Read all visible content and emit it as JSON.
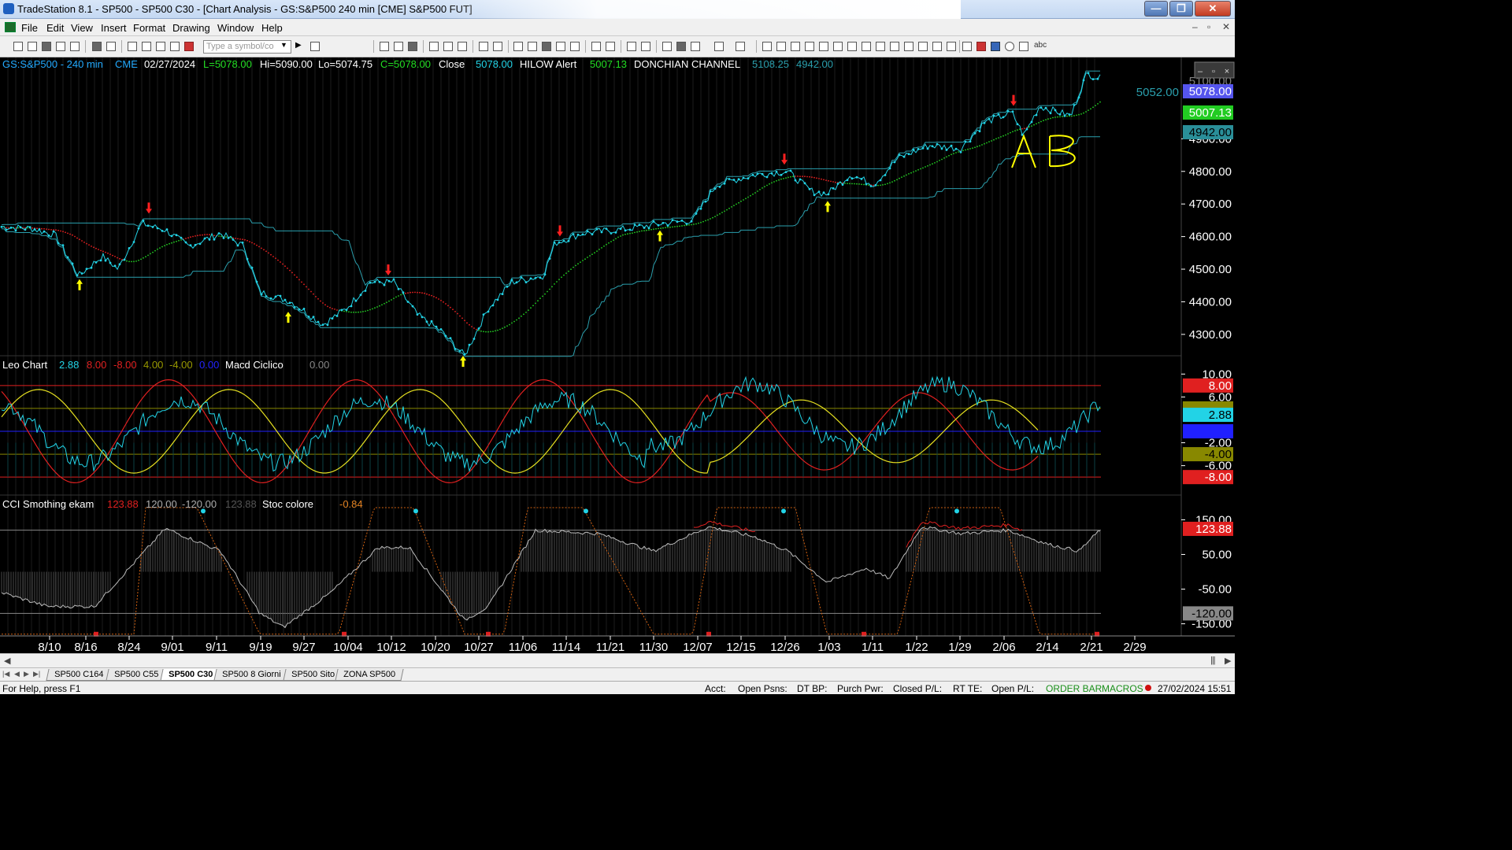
{
  "window": {
    "title": "TradeStation 8.1 - SP500 - SP500 C30 - [Chart Analysis - GS:S&P500  240 min  [CME] S&P500 FUT]",
    "min_label": "—",
    "max_label": "❐",
    "close_label": "✕"
  },
  "menu": {
    "items": [
      "File",
      "Edit",
      "View",
      "Insert",
      "Format",
      "Drawing",
      "Window",
      "Help"
    ],
    "mdi_min": "–",
    "mdi_restore": "▫",
    "mdi_close": "✕"
  },
  "toolbar": {
    "symbol_placeholder": "Type a symbol/co",
    "abc_label": "abc"
  },
  "chart": {
    "symbol_header": {
      "symbol": "GS:S&P500 - 240 min",
      "exchange": "CME",
      "date": "02/27/2024",
      "low_open": "L=5078.00",
      "high": "Hi=5090.00",
      "low": "Lo=5074.75",
      "close_val": "C=5078.00",
      "close_label": "Close",
      "close_num": "5078.00",
      "hilow_label": "HILOW Alert",
      "hilow_val": "5007.13",
      "donchian_label": "DONCHIAN CHANNEL",
      "donchian_hi": "5108.25",
      "donchian_lo": "4942.00"
    },
    "price_axis": {
      "ticks": [
        "4900.00",
        "4800.00",
        "4700.00",
        "4600.00",
        "4500.00",
        "4400.00",
        "4300.00"
      ],
      "partial_tick": "5100.00",
      "labels": {
        "last": "5078.00",
        "hilow": "5007.13",
        "donchian_lo": "4942.00"
      },
      "inner_label": "5052.00"
    },
    "annotation_text": "AB",
    "leo_header": {
      "name": "Leo Chart",
      "v1": "2.88",
      "v2": "8.00",
      "v3": "-8.00",
      "v4": "4.00",
      "v5": "-4.00",
      "v6": "0.00",
      "macd_label": "Macd Ciclico",
      "macd_val": "0.00"
    },
    "leo_axis": {
      "ticks": [
        "10.00",
        "6.00",
        "-2.00",
        "-6.00"
      ],
      "labels": {
        "v8": "8.00",
        "v4": "4.00",
        "v288": "2.88",
        "v0": "0.00",
        "vm4": "-4.00",
        "vm8": "-8.00"
      }
    },
    "cci_header": {
      "name": "CCI Smothing ekam",
      "v1": "123.88",
      "v2": "120.00",
      "v3": "-120.00",
      "v4": "123.88",
      "stoc_label": "Stoc colore",
      "stoc_val": "-0.84"
    },
    "cci_axis": {
      "ticks": [
        "150.00",
        "50.00",
        "-50.00",
        "-150.00"
      ],
      "labels": {
        "v123": "123.88",
        "vm120": "-120.00"
      }
    },
    "date_axis": [
      "8/10",
      "8/16",
      "8/24",
      "9/01",
      "9/11",
      "9/19",
      "9/27",
      "10/04",
      "10/12",
      "10/20",
      "10/27",
      "11/06",
      "11/14",
      "11/21",
      "11/30",
      "12/07",
      "12/15",
      "12/26",
      "1/03",
      "1/11",
      "1/22",
      "1/29",
      "2/06",
      "2/14",
      "2/21",
      "2/29"
    ]
  },
  "tabs": [
    {
      "label": "SP500 C164",
      "active": false
    },
    {
      "label": "SP500 C55",
      "active": false
    },
    {
      "label": "SP500 C30",
      "active": true
    },
    {
      "label": "SP500 8 Giorni",
      "active": false
    },
    {
      "label": "SP500 Sito",
      "active": false
    },
    {
      "label": "ZONA SP500",
      "active": false
    }
  ],
  "status": {
    "help": "For Help, press F1",
    "acct": "Acct:",
    "open_psns": "Open Psns:",
    "dt_bp": "DT BP:",
    "purch_pwr": "Purch Pwr:",
    "closed_pl": "Closed P/L:",
    "rt_te": "RT TE:",
    "open_pl": "Open P/L:",
    "order_bar": "ORDER BAR",
    "macros": "MACROS",
    "datetime": "27/02/2024 15:51"
  },
  "colors": {
    "price": "#22d3e6",
    "channel": "#2a9fad",
    "hilow_red": "#e82020",
    "hilow_green": "#22cc22",
    "cyclic_red": "#e02020",
    "cyclic_yellow": "#e6e020",
    "annotation": "#ffff00",
    "up_arrow": "#ffff00",
    "down_arrow": "#ff2020"
  }
}
